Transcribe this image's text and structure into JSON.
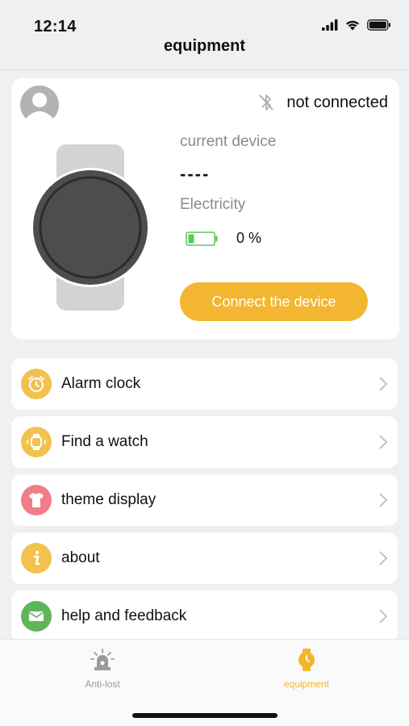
{
  "status": {
    "time": "12:14"
  },
  "nav": {
    "title": "equipment"
  },
  "device": {
    "connection_status": "not connected",
    "current_label": "current device",
    "device_name": "----",
    "electricity_label": "Electricity",
    "battery_percent": "0 %",
    "connect_button": "Connect the device"
  },
  "menu": [
    {
      "label": "Alarm clock",
      "icon": "alarm-clock-icon",
      "color": "#f2c14e"
    },
    {
      "label": "Find a watch",
      "icon": "watch-icon",
      "color": "#f2c14e"
    },
    {
      "label": "theme display",
      "icon": "tshirt-icon",
      "color": "#ef7e86"
    },
    {
      "label": "about",
      "icon": "info-icon",
      "color": "#f2c14e"
    },
    {
      "label": "help and feedback",
      "icon": "mail-icon",
      "color": "#5fb65a"
    }
  ],
  "tabs": [
    {
      "label": "Anti-lost",
      "icon": "alarm-light-icon",
      "active": false
    },
    {
      "label": "equipment",
      "icon": "watch-icon",
      "active": true
    }
  ],
  "colors": {
    "accent": "#f2b630",
    "battery": "#5cc85c",
    "inactive": "#9a9a9a"
  }
}
